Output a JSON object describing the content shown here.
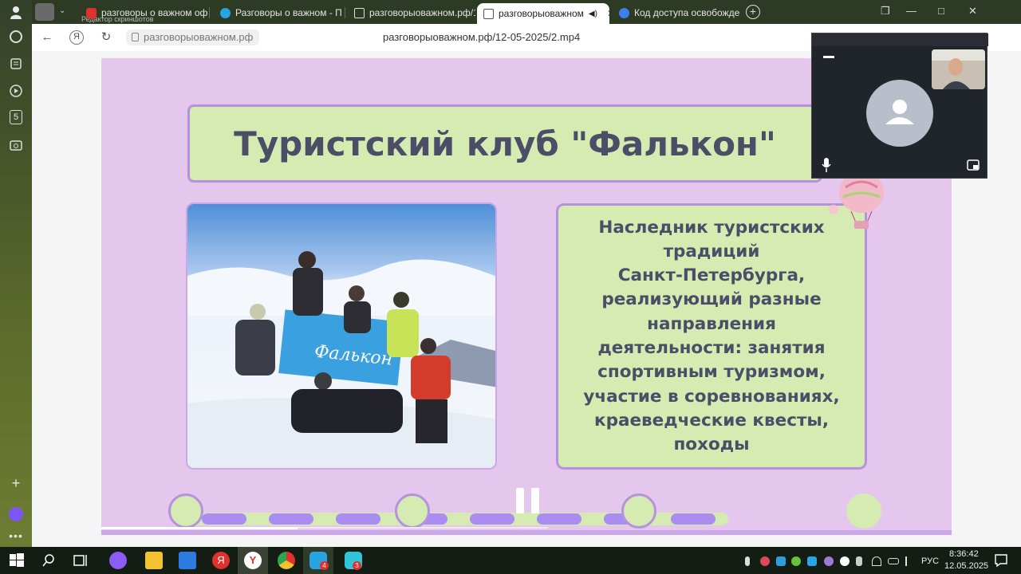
{
  "browser": {
    "tooltip": "Редактор скриншотов",
    "tabs": [
      {
        "label": "разговоры о важном оф",
        "favicon": "yandex-favicon",
        "active": false
      },
      {
        "label": "Разговоры о важном - П",
        "favicon": "telegram-favicon",
        "active": false
      },
      {
        "label": "разговорыоважном.рф/1",
        "favicon": "page-favicon",
        "active": false
      },
      {
        "label": "разговорыоважном",
        "favicon": "page-favicon",
        "active": true,
        "muted_icon": "speaker-icon"
      },
      {
        "label": "Код доступа освобожден",
        "favicon": "blue-circle-favicon",
        "active": false
      }
    ],
    "address": {
      "domain": "разговорыоважном.рф",
      "title": "разговорыоважном.рф/12-05-2025/2.mp4"
    }
  },
  "slide": {
    "title": "Туристский клуб \"Фалькон\"",
    "description_lines": [
      "Наследник туристских",
      "традиций",
      "Санкт-Петербурга,",
      "реализующий разные",
      "направления",
      "деятельности: занятия",
      "спортивным туризмом,",
      "участие в соревнованиях,",
      "краеведческие квесты,",
      "походы"
    ],
    "flag_text": "Фалькон"
  },
  "player": {
    "progress": 0.44,
    "state": "playing",
    "pause_icon": "pause-icon"
  },
  "call": {
    "mic_icon": "microphone-icon",
    "pip_icon": "picture-in-picture-icon"
  },
  "taskbar": {
    "language": "РУС",
    "time": "8:36:42",
    "date": "12.05.2025",
    "badges": {
      "vk": "4",
      "messenger": "3"
    }
  },
  "colors": {
    "slide_bg": "#e5c6ec",
    "box_green": "#d5ebb2",
    "border_purple": "#b493dc",
    "text_dark": "#4c4d66",
    "track_purple": "#a98df0"
  }
}
